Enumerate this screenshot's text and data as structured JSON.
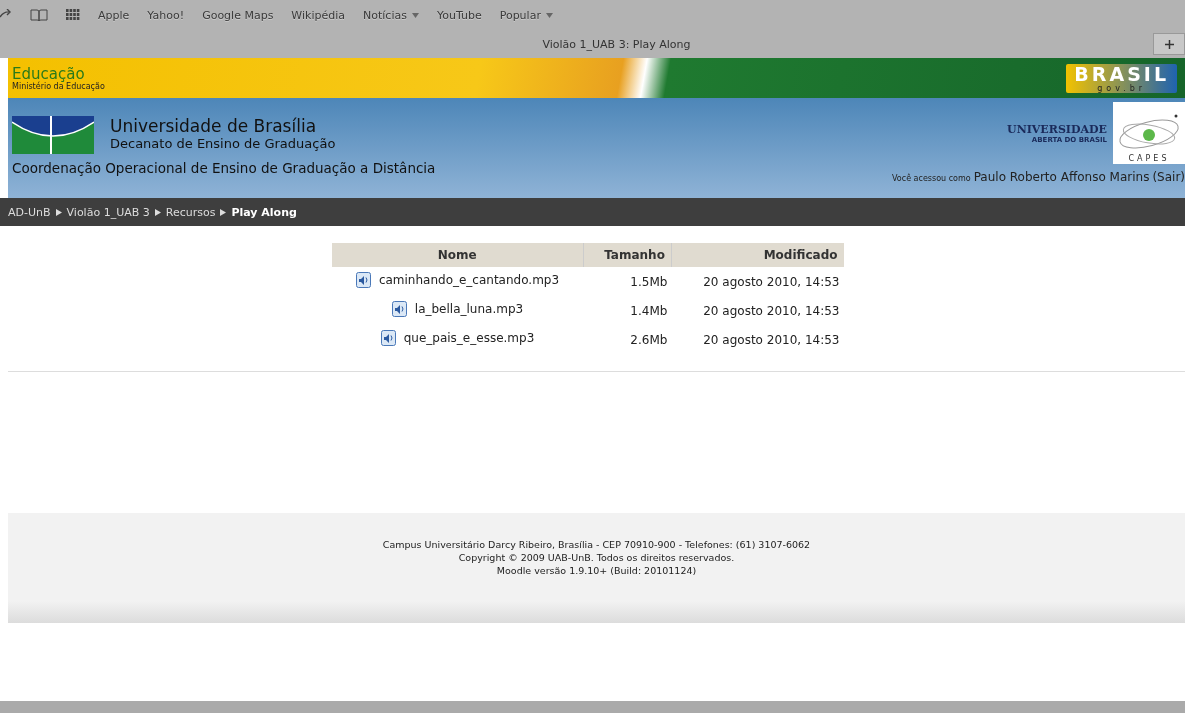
{
  "bookmarks": [
    {
      "label": "Apple",
      "dropdown": false
    },
    {
      "label": "Yahoo!",
      "dropdown": false
    },
    {
      "label": "Google Maps",
      "dropdown": false
    },
    {
      "label": "Wikipédia",
      "dropdown": false
    },
    {
      "label": "Notícias",
      "dropdown": true
    },
    {
      "label": "YouTube",
      "dropdown": false
    },
    {
      "label": "Popular",
      "dropdown": true
    }
  ],
  "window": {
    "title": "Violão 1_UAB 3: Play Along"
  },
  "banner": {
    "title": "Educação",
    "subtitle": "Ministério da Educação",
    "logo": "BRASIL",
    "logo_sub": "gov.br"
  },
  "header": {
    "university": "Universidade de Brasília",
    "dean": "Decanato de Ensino de Graduação",
    "coordination": "Coordenação Operacional de Ensino de Graduação a Distância",
    "uab_title": "UNIVERSIDADE",
    "uab_subtitle": "ABERTA DO BRASIL",
    "capes": "CAPES",
    "login_prefix": "Você acessou como",
    "user": "Paulo Roberto Affonso Marins",
    "logout": "(Sair)"
  },
  "breadcrumb": [
    "AD-UnB",
    "Violão 1_UAB 3",
    "Recursos",
    "Play Along"
  ],
  "table": {
    "columns": [
      "Nome",
      "Tamanho",
      "Modificado"
    ],
    "rows": [
      {
        "name": "caminhando_e_cantando.mp3",
        "size": "1.5Mb",
        "modified": "20 agosto 2010, 14:53"
      },
      {
        "name": "la_bella_luna.mp3",
        "size": "1.4Mb",
        "modified": "20 agosto 2010, 14:53"
      },
      {
        "name": "que_pais_e_esse.mp3",
        "size": "2.6Mb",
        "modified": "20 agosto 2010, 14:53"
      }
    ]
  },
  "footer": [
    "Campus Universitário Darcy Ribeiro, Brasília - CEP 70910-900 - Telefones: (61) 3107-6062",
    "Copyright © 2009 UAB-UnB. Todos os direitos reservados.",
    "Moodle versão 1.9.10+ (Build: 20101124)"
  ]
}
